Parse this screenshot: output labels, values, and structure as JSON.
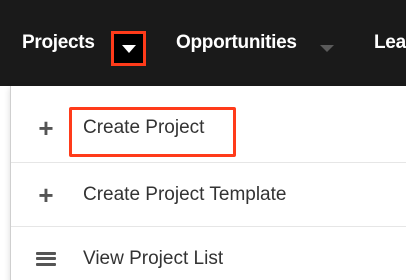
{
  "nav": {
    "projects_label": "Projects",
    "opportunities_label": "Opportunities",
    "more_label": "Lea",
    "dropdown_icon": "chevron-down-icon"
  },
  "menu": {
    "items": [
      {
        "icon": "plus-icon",
        "label": "Create Project",
        "highlighted": true
      },
      {
        "icon": "plus-icon",
        "label": "Create Project Template",
        "highlighted": false
      },
      {
        "icon": "list-icon",
        "label": "View Project List",
        "highlighted": false
      }
    ]
  },
  "colors": {
    "navbar_bg": "#1a1a1a",
    "highlight": "#ff3b1a",
    "text": "#333333",
    "icon": "#555555"
  }
}
